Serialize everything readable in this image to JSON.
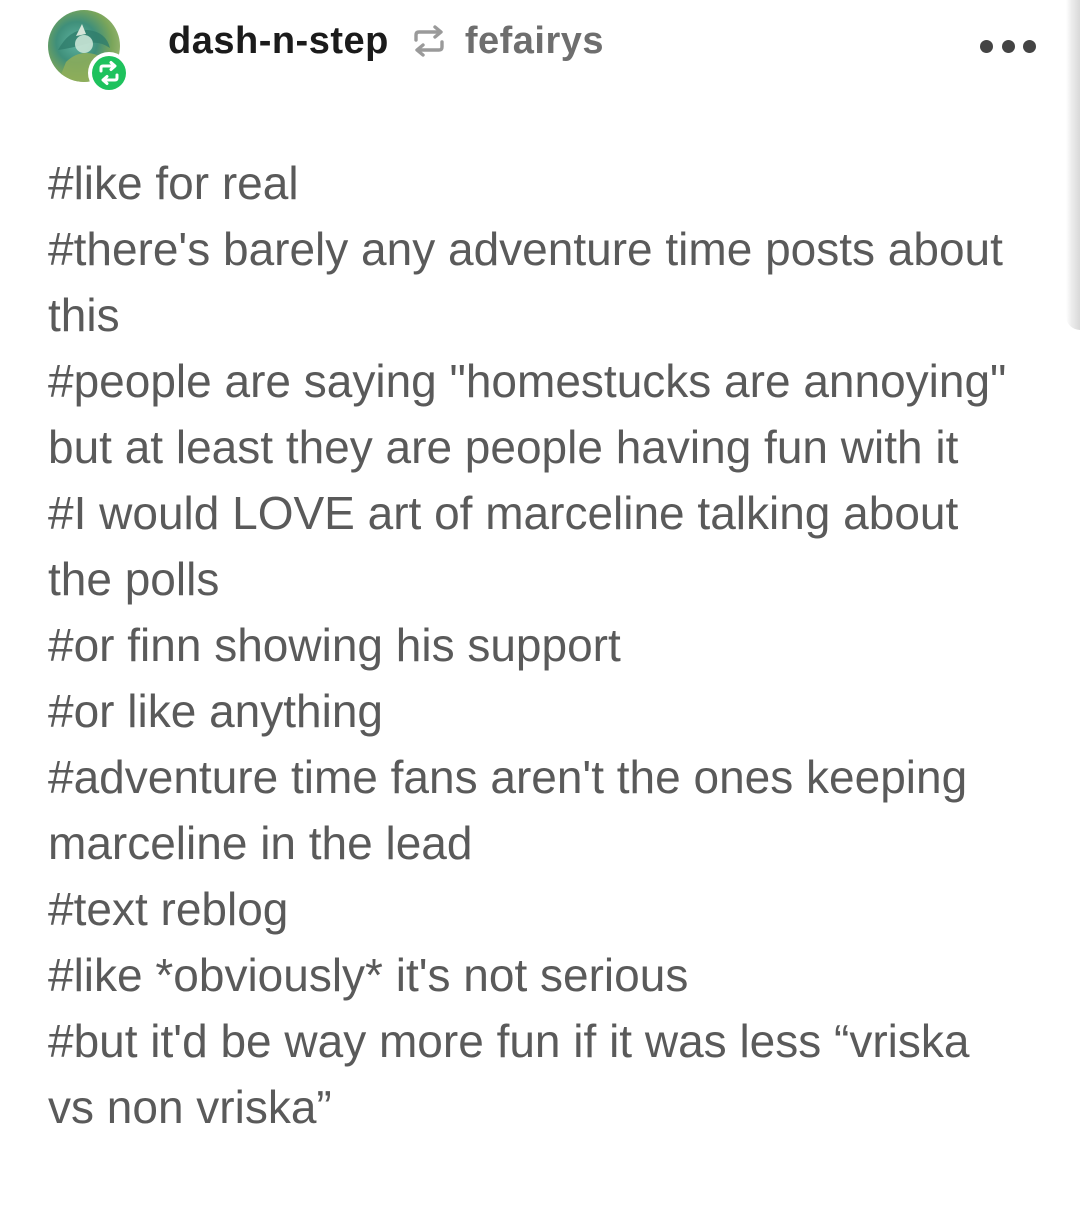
{
  "post": {
    "reblogger": "dash-n-step",
    "source": "fefairys",
    "tags": [
      "#like for real",
      "#there's barely any adventure time posts about this",
      "#people are saying \"homestucks are annoying\" but at least they are people having fun with it",
      "#I would LOVE art of marceline talking about the polls",
      "#or finn showing his support",
      "#or like anything",
      "#adventure time fans aren't the ones keeping marceline in the lead",
      "#text reblog",
      "#like *obviously* it's not serious",
      "#but it'd be way more fun if it was less “vriska vs non vriska”"
    ]
  },
  "icons": {
    "reblog_badge": "reblog-icon",
    "reblog_arrow": "reblog-icon",
    "more": "more-horizontal-icon",
    "avatar": "avatar-image"
  },
  "colors": {
    "badge_green": "#1ec25d",
    "tag_text": "#5a5a5a",
    "name_text": "#1b1b1b"
  }
}
